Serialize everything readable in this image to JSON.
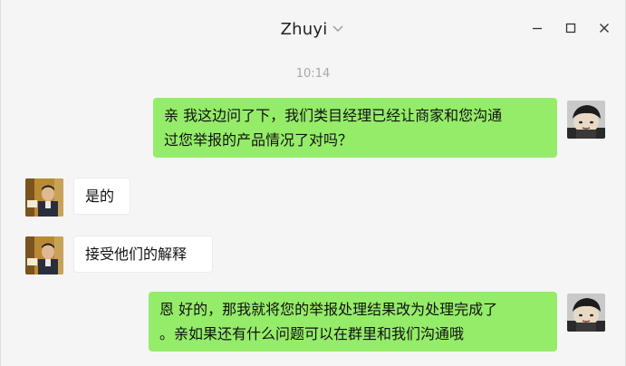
{
  "window": {
    "title": "Zhuyi",
    "controls": [
      "minimize-icon",
      "maximize-icon",
      "close-icon"
    ]
  },
  "chat": {
    "timestamp": "10:14",
    "messages": [
      {
        "direction": "outgoing",
        "lines": [
          "亲 我这边问了下，我们类目经理已经让商家和您沟通",
          "过您举报的产品情况了对吗？"
        ]
      },
      {
        "direction": "incoming",
        "lines": [
          "是的"
        ]
      },
      {
        "direction": "incoming",
        "lines": [
          "接受他们的解释"
        ]
      },
      {
        "direction": "outgoing",
        "lines": [
          "恩  好的，那我就将您的举报处理结果改为处理完成了",
          "。亲如果还有什么问题可以在群里和我们沟通哦"
        ]
      }
    ]
  },
  "colors": {
    "outgoing_bubble": "#95ec69",
    "incoming_bubble": "#ffffff",
    "background": "#f5f5f5"
  }
}
